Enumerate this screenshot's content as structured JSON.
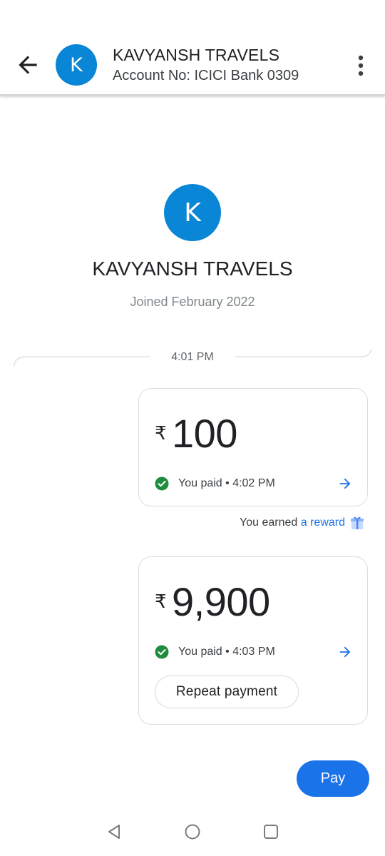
{
  "header": {
    "avatar_letter": "K",
    "title": "KAVYANSH TRAVELS",
    "subtitle": "Account No: ICICI Bank 0309",
    "back_icon": "arrow-left-icon",
    "more_icon": "more-vert-icon"
  },
  "contact": {
    "avatar_letter": "K",
    "name": "KAVYANSH TRAVELS",
    "joined": "Joined February 2022"
  },
  "timeline": {
    "time": "4:01 PM"
  },
  "transactions": [
    {
      "currency": "₹",
      "amount": "100",
      "status": "You paid • 4:02 PM"
    },
    {
      "currency": "₹",
      "amount": "9,900",
      "status": "You paid • 4:03 PM",
      "repeat_label": "Repeat payment"
    }
  ],
  "reward": {
    "prefix": "You earned ",
    "link": "a reward",
    "icon": "gift-icon"
  },
  "pay_button": "Pay",
  "colors": {
    "accent": "#1a73e8",
    "avatar": "#0a86d6",
    "success": "#1e8e3e"
  },
  "nav": {
    "back": "nav-back-icon",
    "home": "nav-home-icon",
    "recents": "nav-recents-icon"
  }
}
